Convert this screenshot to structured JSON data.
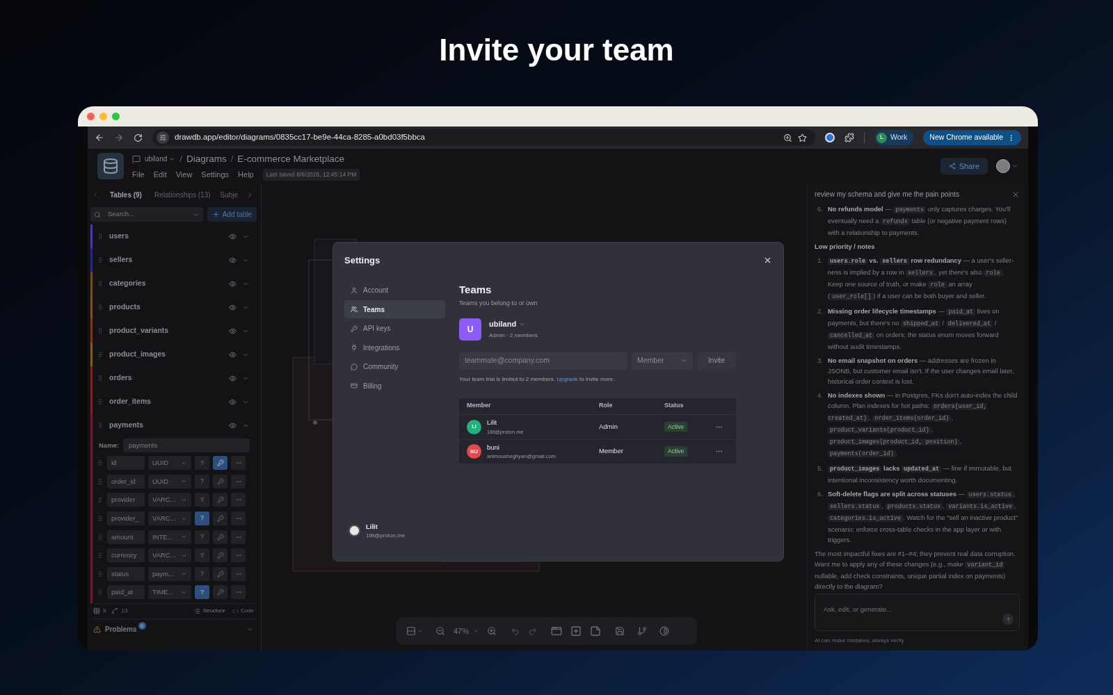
{
  "heading": "Invite your team",
  "browser": {
    "url": "drawdb.app/editor/diagrams/0835cc17-be9e-44ca-8285-a0bd03f5bbca",
    "profile_initial": "L",
    "profile_label": "Work",
    "update_button": "New Chrome available"
  },
  "app": {
    "path": [
      {
        "kind": "workspace",
        "text": "ubiland"
      },
      {
        "kind": "separator",
        "text": "/"
      },
      {
        "kind": "crumb",
        "text": "Diagrams"
      },
      {
        "kind": "separator",
        "text": "/"
      },
      {
        "kind": "crumb",
        "text": "E-commerce Marketplace"
      }
    ],
    "menu": [
      "File",
      "Edit",
      "View",
      "Settings",
      "Help"
    ],
    "last_saved": "Last saved 8/6/2026, 12:45:14 PM",
    "share": "Share"
  },
  "sidebar": {
    "tabs": [
      {
        "label": "Tables (9)",
        "selected": true
      },
      {
        "label": "Relationships (13)",
        "selected": false
      },
      {
        "label": "Subje",
        "selected": false
      }
    ],
    "search_placeholder": "Search...",
    "add_table": "Add table",
    "tables": [
      {
        "name": "users",
        "color": "#4a3aa6",
        "expanded": false
      },
      {
        "name": "sellers",
        "color": "#2b2680",
        "expanded": false
      },
      {
        "name": "categories",
        "color": "#6e5220",
        "expanded": false
      },
      {
        "name": "products",
        "color": "#7c5420",
        "expanded": false
      },
      {
        "name": "product_variants",
        "color": "#7a3a22",
        "expanded": false
      },
      {
        "name": "product_images",
        "color": "#7a5e22",
        "expanded": false
      },
      {
        "name": "orders",
        "color": "#7e2222",
        "expanded": false
      },
      {
        "name": "order_items",
        "color": "#7c2230",
        "expanded": false
      },
      {
        "name": "payments",
        "color": "#6e1a32",
        "expanded": true
      }
    ],
    "name_label": "Name:",
    "name_value": "payments",
    "null_label": "?",
    "fields": [
      {
        "name": "id",
        "type": "UUID",
        "nullable": false,
        "primary": true
      },
      {
        "name": "order_id",
        "type": "UUID",
        "nullable": false,
        "primary": false
      },
      {
        "name": "provider",
        "type": "VARC...",
        "nullable": false,
        "primary": false
      },
      {
        "name": "provider_",
        "type": "VARC...",
        "nullable": true,
        "primary": false
      },
      {
        "name": "amount",
        "type": "INTE...",
        "nullable": false,
        "primary": false
      },
      {
        "name": "currency",
        "type": "VARC...",
        "nullable": false,
        "primary": false
      },
      {
        "name": "status",
        "type": "paym...",
        "nullable": false,
        "primary": false
      },
      {
        "name": "paid_at",
        "type": "TIME...",
        "nullable": true,
        "primary": false
      }
    ],
    "footer": {
      "tables_count": "9",
      "relationships_count": "13",
      "structure": "Structure",
      "code": "Code"
    },
    "problems": {
      "label": "Problems",
      "count": "0"
    }
  },
  "toolbar": {
    "zoom": "47%"
  },
  "settings": {
    "title": "Settings",
    "nav": [
      {
        "label": "Account",
        "selected": false
      },
      {
        "label": "Teams",
        "selected": true
      },
      {
        "label": "API keys",
        "selected": false
      },
      {
        "label": "Integrations",
        "selected": false
      },
      {
        "label": "Community",
        "selected": false
      },
      {
        "label": "Billing",
        "selected": false
      }
    ],
    "user": {
      "name": "Lilit",
      "email": "1ilit@proton.me"
    },
    "heading": "Teams",
    "subtitle": "Teams you belong to or own",
    "team": {
      "initial": "U",
      "name": "ubiland",
      "meta": "Admin · 2 members"
    },
    "invite": {
      "placeholder": "teammate@company.com",
      "role": "Member",
      "button": "Invite"
    },
    "note": {
      "before": "Your team trial is limited to 2 members. ",
      "link": "Upgrade",
      "after": " to invite more."
    },
    "columns": [
      "Member",
      "Role",
      "Status"
    ],
    "members": [
      {
        "initials": "LI",
        "color": "#22b07d",
        "name": "Lilit",
        "email": "1ilit@proton.me",
        "role": "Admin",
        "status": "Active"
      },
      {
        "initials": "BU",
        "color": "#e5484d",
        "name": "buni",
        "email": "animousheghyan@gmail.com",
        "role": "Member",
        "status": "Active"
      }
    ]
  },
  "chat": {
    "prompt": "review my schema and give me the pain points",
    "blocks": [
      {
        "kind": "item",
        "number": "6.",
        "segments": [
          {
            "kind": "bold",
            "text": "No refunds model"
          },
          {
            "kind": "plain",
            "text": " — "
          },
          {
            "kind": "code",
            "text": "payments"
          },
          {
            "kind": "plain",
            "text": " only captures charges. You'll eventually need a "
          },
          {
            "kind": "code",
            "text": "refunds"
          },
          {
            "kind": "plain",
            "text": " table (or negative payment rows) with a relationship to payments."
          }
        ]
      },
      {
        "kind": "heading",
        "segments": [
          {
            "kind": "bold",
            "text": "Low priority / notes"
          }
        ]
      },
      {
        "kind": "item",
        "number": "1.",
        "segments": [
          {
            "kind": "boldcode",
            "text": "users.role"
          },
          {
            "kind": "bold",
            "text": " vs. "
          },
          {
            "kind": "boldcode",
            "text": "sellers"
          },
          {
            "kind": "bold",
            "text": " row redundancy"
          },
          {
            "kind": "plain",
            "text": " — a user's seller-ness is implied by a row in "
          },
          {
            "kind": "code",
            "text": "sellers"
          },
          {
            "kind": "plain",
            "text": ", yet there's also "
          },
          {
            "kind": "code",
            "text": "role"
          },
          {
            "kind": "plain",
            "text": ". Keep one source of truth, or make "
          },
          {
            "kind": "code",
            "text": "role"
          },
          {
            "kind": "plain",
            "text": " an array ("
          },
          {
            "kind": "code",
            "text": "user_role[]"
          },
          {
            "kind": "plain",
            "text": ") if a user can be both buyer and seller."
          }
        ]
      },
      {
        "kind": "item",
        "number": "2.",
        "segments": [
          {
            "kind": "bold",
            "text": "Missing order lifecycle timestamps"
          },
          {
            "kind": "plain",
            "text": " — "
          },
          {
            "kind": "code",
            "text": "paid_at"
          },
          {
            "kind": "plain",
            "text": " lives on payments, but there's no "
          },
          {
            "kind": "code",
            "text": "shipped_at"
          },
          {
            "kind": "plain",
            "text": " / "
          },
          {
            "kind": "code",
            "text": "delivered_at"
          },
          {
            "kind": "plain",
            "text": " / "
          },
          {
            "kind": "code",
            "text": "cancelled_at"
          },
          {
            "kind": "plain",
            "text": " on orders; the status enum moves forward without audit timestamps."
          }
        ]
      },
      {
        "kind": "item",
        "number": "3.",
        "segments": [
          {
            "kind": "bold",
            "text": "No email snapshot on orders"
          },
          {
            "kind": "plain",
            "text": " — addresses are frozen in JSONB, but customer email isn't. If the user changes email later, historical order context is lost."
          }
        ]
      },
      {
        "kind": "item",
        "number": "4.",
        "segments": [
          {
            "kind": "bold",
            "text": "No indexes shown"
          },
          {
            "kind": "plain",
            "text": " — in Postgres, FKs don't auto-index the child column. Plan indexes for hot paths: "
          },
          {
            "kind": "code",
            "text": "orders(user_id, created_at)"
          },
          {
            "kind": "plain",
            "text": ", "
          },
          {
            "kind": "code",
            "text": "order_items(order_id)"
          },
          {
            "kind": "plain",
            "text": ", "
          },
          {
            "kind": "code",
            "text": "product_variants(product_id)"
          },
          {
            "kind": "plain",
            "text": ", "
          },
          {
            "kind": "code",
            "text": "product_images(product_id, position)"
          },
          {
            "kind": "plain",
            "text": ", "
          },
          {
            "kind": "code",
            "text": "payments(order_id)"
          },
          {
            "kind": "plain",
            "text": "."
          }
        ]
      },
      {
        "kind": "item",
        "number": "5.",
        "segments": [
          {
            "kind": "boldcode",
            "text": "product_images"
          },
          {
            "kind": "bold",
            "text": " lacks "
          },
          {
            "kind": "boldcode",
            "text": "updated_at"
          },
          {
            "kind": "plain",
            "text": " — fine if immutable, but intentional inconsistency worth documenting."
          }
        ]
      },
      {
        "kind": "item",
        "number": "6.",
        "segments": [
          {
            "kind": "bold",
            "text": "Soft-delete flags are split across statuses"
          },
          {
            "kind": "plain",
            "text": " — "
          },
          {
            "kind": "code",
            "text": "users.status"
          },
          {
            "kind": "plain",
            "text": ", "
          },
          {
            "kind": "code",
            "text": "sellers.status"
          },
          {
            "kind": "plain",
            "text": ", "
          },
          {
            "kind": "code",
            "text": "products.status"
          },
          {
            "kind": "plain",
            "text": ", "
          },
          {
            "kind": "code",
            "text": "variants.is_active"
          },
          {
            "kind": "plain",
            "text": ", "
          },
          {
            "kind": "code",
            "text": "categories.is_active"
          },
          {
            "kind": "plain",
            "text": ". Watch for the \"sell an inactive product\" scenario; enforce cross-table checks in the app layer or with triggers."
          }
        ]
      },
      {
        "kind": "paragraph",
        "segments": [
          {
            "kind": "plain",
            "text": "The most impactful fixes are #1–#4; they prevent real data corruption. Want me to apply any of these changes (e.g., make "
          },
          {
            "kind": "code",
            "text": "variant_id"
          },
          {
            "kind": "plain",
            "text": " nullable, add check constraints, unique partial index on payments) directly to the diagram?"
          }
        ]
      }
    ],
    "input_placeholder": "Ask, edit, or generate...",
    "disclaimer": "AI can make mistakes, always verify"
  }
}
